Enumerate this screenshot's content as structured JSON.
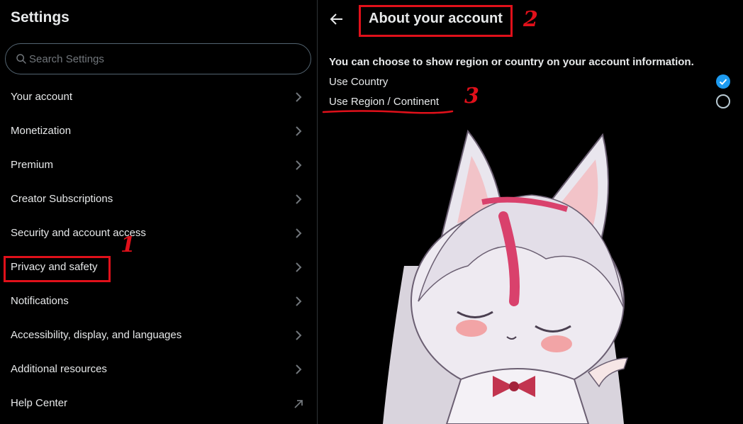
{
  "sidebar": {
    "title": "Settings",
    "search_placeholder": "Search Settings",
    "items": [
      {
        "label": "Your account",
        "icon": "chevron-right-icon"
      },
      {
        "label": "Monetization",
        "icon": "chevron-right-icon"
      },
      {
        "label": "Premium",
        "icon": "chevron-right-icon"
      },
      {
        "label": "Creator Subscriptions",
        "icon": "chevron-right-icon"
      },
      {
        "label": "Security and account access",
        "icon": "chevron-right-icon"
      },
      {
        "label": "Privacy and safety",
        "icon": "chevron-right-icon"
      },
      {
        "label": "Notifications",
        "icon": "chevron-right-icon"
      },
      {
        "label": "Accessibility, display, and languages",
        "icon": "chevron-right-icon"
      },
      {
        "label": "Additional resources",
        "icon": "chevron-right-icon"
      },
      {
        "label": "Help Center",
        "icon": "external-link-arrow-icon"
      }
    ]
  },
  "main": {
    "title": "About your account",
    "description": "You can choose to show region or country on your account information.",
    "options": [
      {
        "label": "Use Country",
        "selected": true
      },
      {
        "label": "Use Region / Continent",
        "selected": false
      }
    ]
  },
  "annotations": [
    {
      "number": "1",
      "target": "Privacy and safety"
    },
    {
      "number": "2",
      "target": "About your account"
    },
    {
      "number": "3",
      "target": "Use Region / Continent"
    }
  ],
  "colors": {
    "background": "#000000",
    "text": "#e7e9ea",
    "muted": "#71767b",
    "accent": "#1d9bf0",
    "annotation": "#e0101a",
    "divider": "#2f3336"
  }
}
